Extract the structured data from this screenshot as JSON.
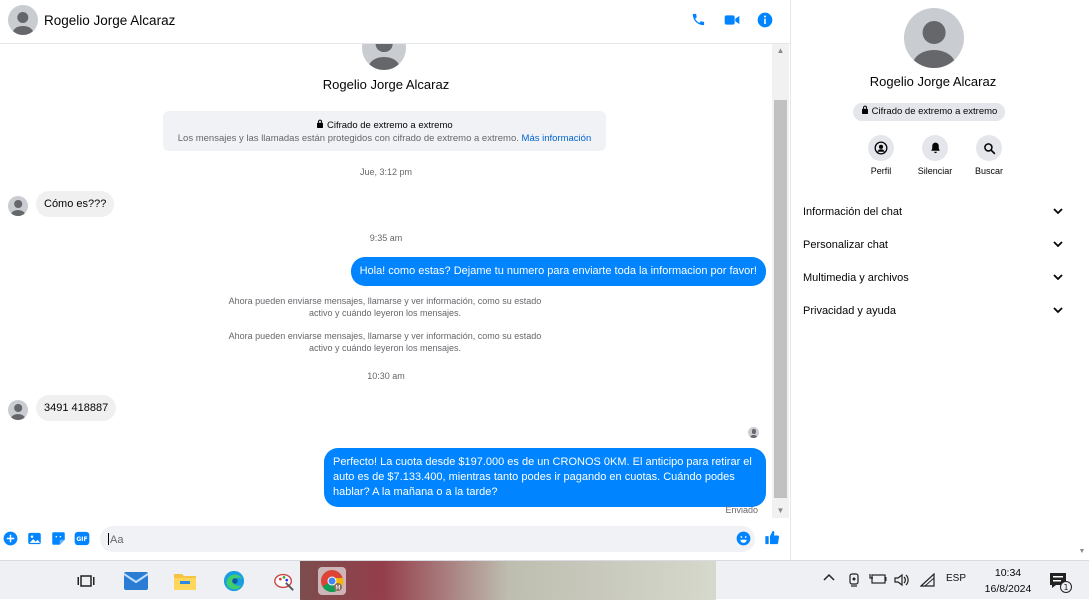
{
  "header": {
    "contact_name": "Rogelio Jorge Alcaraz",
    "icons": [
      "phone-icon",
      "video-icon",
      "info-icon"
    ],
    "accent_color": "#0084ff"
  },
  "conversation": {
    "contact_name": "Rogelio Jorge Alcaraz",
    "e2e_title": "Cifrado de extremo a extremo",
    "e2e_text": "Los mensajes y las llamadas están protegidos con cifrado de extremo a extremo.",
    "e2e_link": "Más información",
    "timestamp_1": "Jue, 3:12 pm",
    "msg_in_1": "Cómo es???",
    "timestamp_2": "9:35 am",
    "msg_out_1": "Hola! como estas? Dejame tu numero para enviarte toda la informacion por favor!",
    "system_msg_1": "Ahora pueden enviarse mensajes, llamarse y ver información, como su estado activo y cuándo leyeron los mensajes.",
    "system_msg_2": "Ahora pueden enviarse mensajes, llamarse y ver información, como su estado activo y cuándo leyeron los mensajes.",
    "timestamp_3": "10:30 am",
    "msg_in_2": "3491 418887",
    "msg_out_2": "Perfecto! La cuota desde $197.000 es de un CRONOS 0KM. El anticipo para retirar el auto es de $7.133.400, mientras tanto podes ir pagando en cuotas. Cuándo podes hablar? A la mañana o a la tarde?",
    "status": "Enviado"
  },
  "composer": {
    "placeholder": "Aa",
    "icons": [
      "plus-icon",
      "image-icon",
      "sticker-icon",
      "gif-icon",
      "emoji-icon",
      "like-icon"
    ],
    "gif_label": "GIF"
  },
  "side_panel": {
    "contact_name": "Rogelio Jorge Alcaraz",
    "badge": "Cifrado de extremo a extremo",
    "actions": [
      {
        "label": "Perfil",
        "icon": "profile-icon"
      },
      {
        "label": "Silenciar",
        "icon": "bell-icon"
      },
      {
        "label": "Buscar",
        "icon": "search-icon"
      }
    ],
    "sections": [
      {
        "label": "Información del chat"
      },
      {
        "label": "Personalizar chat"
      },
      {
        "label": "Multimedia y archivos"
      },
      {
        "label": "Privacidad y ayuda"
      }
    ]
  },
  "taskbar": {
    "apps": [
      "task-view-icon",
      "mail-icon",
      "file-explorer-icon",
      "edge-icon",
      "paint-icon",
      "chrome-icon"
    ],
    "language": "ESP",
    "time": "10:34",
    "date": "16/8/2024",
    "notification_count": "1"
  }
}
